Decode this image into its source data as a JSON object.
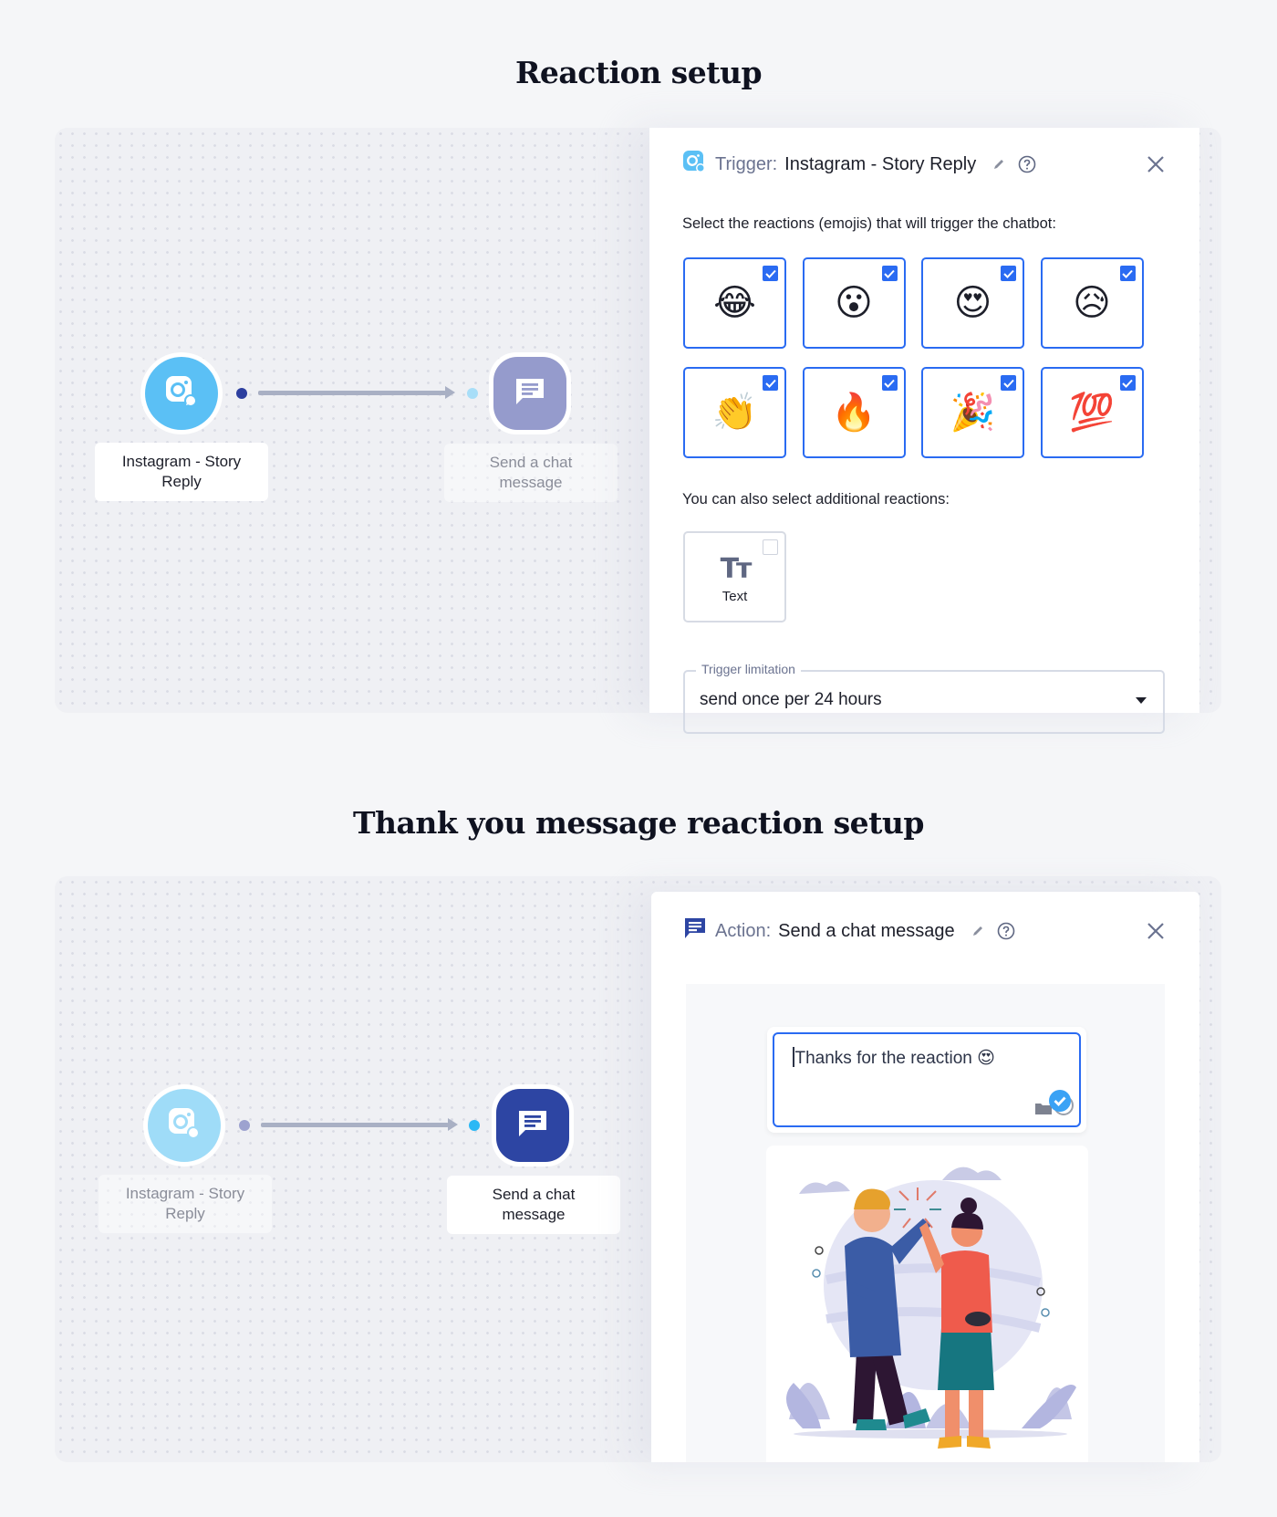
{
  "sections": [
    {
      "title": "Reaction setup",
      "flow": {
        "trigger_node": {
          "label": "Instagram - Story Reply",
          "state": "active",
          "color": "#5bc0f5"
        },
        "action_node": {
          "label": "Send a chat message",
          "state": "inactive",
          "color": "#959bcc"
        }
      },
      "panel": {
        "kind": "Trigger:",
        "name": "Instagram - Story Reply",
        "prompt": "Select the reactions (emojis) that will trigger the chatbot:",
        "reactions": [
          {
            "emoji": "😂",
            "name": "face-with-tears-of-joy",
            "checked": true
          },
          {
            "emoji": "😮",
            "name": "face-with-open-mouth",
            "checked": true
          },
          {
            "emoji": "😍",
            "name": "heart-eyes",
            "checked": true
          },
          {
            "emoji": "😥",
            "name": "sad-but-relieved-face",
            "checked": true
          },
          {
            "emoji": "👏",
            "name": "clapping-hands",
            "checked": true
          },
          {
            "emoji": "🔥",
            "name": "fire",
            "checked": true
          },
          {
            "emoji": "🎉",
            "name": "party-popper",
            "checked": true
          },
          {
            "emoji": "💯",
            "name": "hundred-points",
            "checked": true
          }
        ],
        "additional_prompt": "You can also select additional reactions:",
        "additional": [
          {
            "icon": "Tт",
            "label": "Text",
            "checked": false
          }
        ],
        "trigger_limitation": {
          "legend": "Trigger limitation",
          "value": "send once per 24 hours"
        }
      }
    },
    {
      "title": "Thank you message reaction setup",
      "flow": {
        "trigger_node": {
          "label": "Instagram - Story Reply",
          "state": "inactive",
          "color": "#9fdcf8"
        },
        "action_node": {
          "label": "Send a chat message",
          "state": "active",
          "color": "#2d45a3"
        }
      },
      "panel": {
        "kind": "Action:",
        "name": "Send a chat message",
        "message_text": "Thanks for the reaction 😍",
        "image_alt": "Two people giving a high five"
      }
    }
  ],
  "colors": {
    "accent": "#2a6bf2",
    "instagram_blue": "#5bc0f5",
    "chat_navy": "#2d45a3",
    "background": "#f5f6f8"
  }
}
